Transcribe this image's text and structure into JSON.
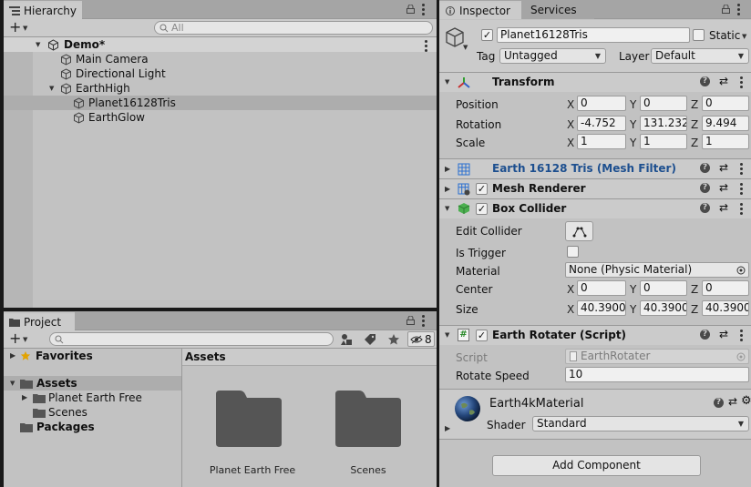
{
  "hierarchy": {
    "tab_label": "Hierarchy",
    "search_placeholder": "All",
    "scene_name": "Demo*",
    "items": [
      {
        "label": "Main Camera"
      },
      {
        "label": "Directional Light"
      },
      {
        "label": "EarthHigh"
      },
      {
        "label": "Planet16128Tris"
      },
      {
        "label": "EarthGlow"
      }
    ]
  },
  "project": {
    "tab_label": "Project",
    "hidden_count": "8",
    "sidebar": {
      "favorites": "Favorites",
      "assets": "Assets",
      "asset_children": [
        "Planet Earth Free",
        "Scenes"
      ],
      "packages": "Packages"
    },
    "breadcrumb": "Assets",
    "folders": [
      "Planet Earth Free",
      "Scenes"
    ]
  },
  "inspector": {
    "tabs": [
      "Inspector",
      "Services"
    ],
    "object_name": "Planet16128Tris",
    "static_label": "Static",
    "tag_label": "Tag",
    "tag_value": "Untagged",
    "layer_label": "Layer",
    "layer_value": "Default",
    "transform": {
      "title": "Transform",
      "position": {
        "label": "Position",
        "x": "0",
        "y": "0",
        "z": "0"
      },
      "rotation": {
        "label": "Rotation",
        "x": "-4.752",
        "y": "131.232",
        "z": "9.494"
      },
      "scale": {
        "label": "Scale",
        "x": "1",
        "y": "1",
        "z": "1"
      }
    },
    "mesh_filter": {
      "title": "Earth 16128 Tris (Mesh Filter)"
    },
    "mesh_renderer": {
      "title": "Mesh Renderer"
    },
    "box_collider": {
      "title": "Box Collider",
      "edit_collider": "Edit Collider",
      "is_trigger": "Is Trigger",
      "material_label": "Material",
      "material_value": "None (Physic Material)",
      "center": {
        "label": "Center",
        "x": "0",
        "y": "0",
        "z": "0"
      },
      "size": {
        "label": "Size",
        "x": "40.39000",
        "y": "40.39000",
        "z": "40.39000"
      }
    },
    "script_comp": {
      "title": "Earth Rotater (Script)",
      "script_label": "Script",
      "script_value": "EarthRotater",
      "speed_label": "Rotate Speed",
      "speed_value": "10"
    },
    "material": {
      "name": "Earth4kMaterial",
      "shader_label": "Shader",
      "shader_value": "Standard"
    },
    "add_component": "Add Component",
    "axis_x": "X",
    "axis_y": "Y",
    "axis_z": "Z"
  },
  "colors": {
    "panel_bg": "#c2c2c2",
    "selected_row": "#adadad",
    "mesh_filter_title": "#1d4f8f"
  }
}
